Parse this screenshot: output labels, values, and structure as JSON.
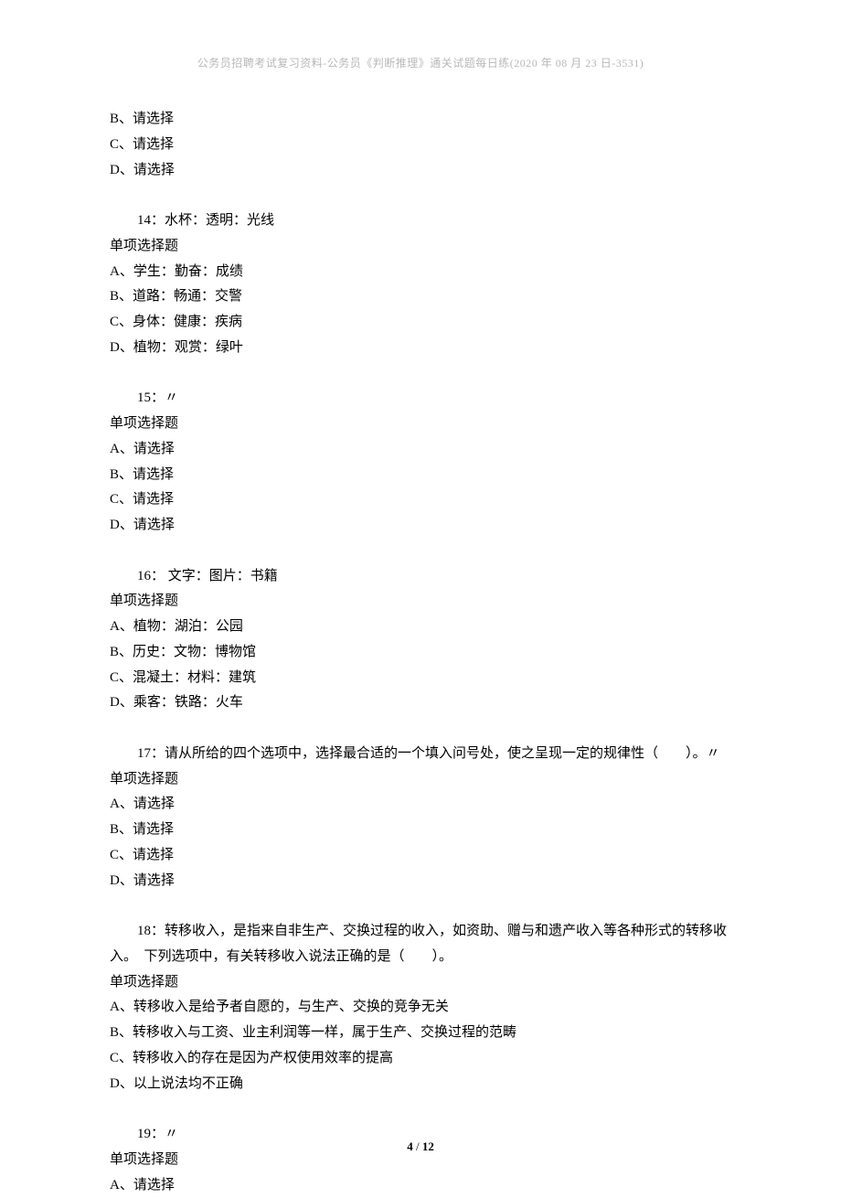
{
  "header": "公务员招聘考试复习资料-公务员《判断推理》通关试题每日练(2020 年 08 月 23 日-3531)",
  "leading_options": [
    "B、请选择",
    "C、请选择",
    "D、请选择"
  ],
  "questions": [
    {
      "stem": "14：水杯：透明：光线",
      "qtype": "单项选择题",
      "options": [
        "A、学生：勤奋：成绩",
        "B、道路：畅通：交警",
        "C、身体：健康：疾病",
        "D、植物：观赏：绿叶"
      ]
    },
    {
      "stem": "15：〃",
      "qtype": "单项选择题",
      "options": [
        "A、请选择",
        "B、请选择",
        "C、请选择",
        "D、请选择"
      ]
    },
    {
      "stem": "16：  文字：图片：书籍",
      "qtype": "单项选择题",
      "options": [
        "A、植物：湖泊：公园",
        "B、历史：文物：博物馆",
        "C、混凝土：材料：建筑",
        "D、乘客：铁路：火车"
      ]
    },
    {
      "stem": "17：请从所给的四个选项中，选择最合适的一个填入问号处，使之呈现一定的规律性（　　）。〃",
      "qtype": "单项选择题",
      "options": [
        "A、请选择",
        "B、请选择",
        "C、请选择",
        "D、请选择"
      ]
    },
    {
      "stem": "18：转移收入，是指来自非生产、交换过程的收入，如资助、赠与和遗产收入等各种形式的转移收入。　下列选项中，有关转移收入说法正确的是（　　）。",
      "qtype": "单项选择题",
      "options": [
        "A、转移收入是给予者自愿的，与生产、交换的竞争无关",
        "B、转移收入与工资、业主利润等一样，属于生产、交换过程的范畴",
        "C、转移收入的存在是因为产权使用效率的提高",
        "D、以上说法均不正确"
      ]
    },
    {
      "stem": "19：〃",
      "qtype": "单项选择题",
      "options": [
        "A、请选择"
      ]
    }
  ],
  "footer": {
    "page": "4",
    "total": "12",
    "sep": " / "
  }
}
